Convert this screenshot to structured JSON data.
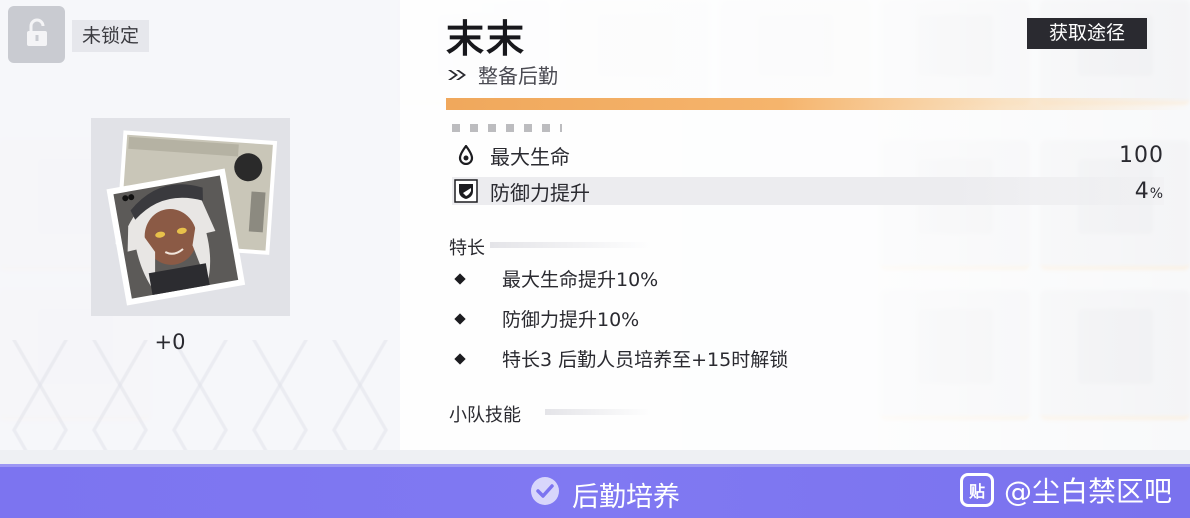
{
  "lock": {
    "label": "未锁定",
    "icon": "lock-icon"
  },
  "portrait": {
    "level": "+0"
  },
  "item": {
    "name": "末末",
    "category": "整备后勤",
    "source_button": "获取途径"
  },
  "stats": [
    {
      "icon": "water-drop-icon",
      "label": "最大生命",
      "value": "100",
      "unit": ""
    },
    {
      "icon": "shield-icon",
      "label": "防御力提升",
      "value": "4",
      "unit": "%"
    }
  ],
  "traits": {
    "title": "特长",
    "items": [
      "最大生命提升10%",
      "防御力提升10%",
      "特长3 后勤人员培养至+15时解锁"
    ]
  },
  "squad_skill": {
    "title": "小队技能"
  },
  "bottom": {
    "train_button": "后勤培养"
  },
  "watermark": {
    "logo": "贴",
    "text": "@尘白禁区吧"
  },
  "colors": {
    "accent": "#7c74f0",
    "progress": "#f0a85c",
    "dark": "#2a2a30"
  }
}
